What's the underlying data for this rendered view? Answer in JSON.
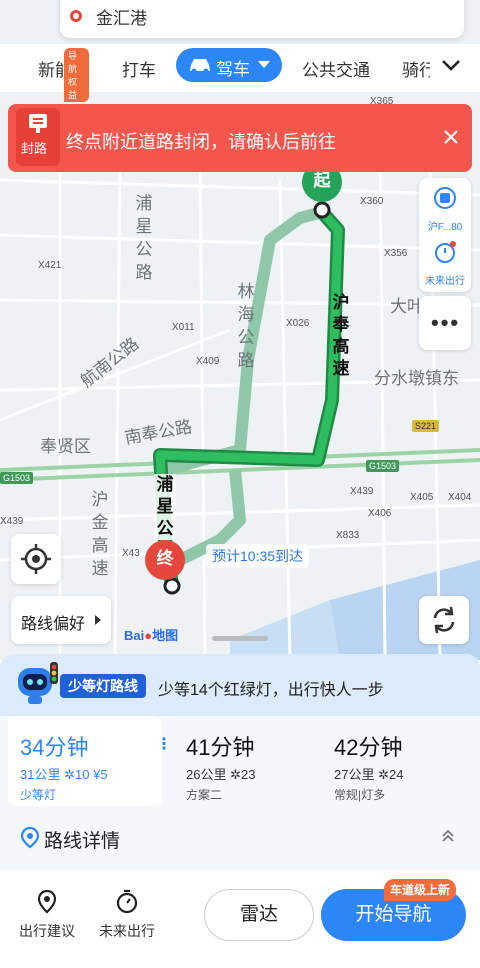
{
  "search": {
    "destination": "金汇港"
  },
  "tabs": {
    "ev": "新能源",
    "ev_badge": "导航权益",
    "taxi": "打车",
    "drive": "驾车",
    "transit": "公共交通",
    "ride": "骑行"
  },
  "alert": {
    "icon_label": "封路",
    "message": "终点附近道路封闭，请确认后前往"
  },
  "right_tools": {
    "road_label": "沪F...80",
    "weather_label": "未来出行"
  },
  "map": {
    "labels": {
      "puxing_road": "浦星公路",
      "linhai_road": "林海公路",
      "hufeng_expressway": "沪奉高速",
      "hangnan_road": "航南公路",
      "nanfeng_road": "南奉公路",
      "fengxian_district": "奉贤区",
      "fenshuidun": "分水墩镇东",
      "dake": "大叶",
      "hujin_expressway": "沪金高速",
      "route_hufeng": "沪奉高速",
      "route_puxing": "浦星公"
    },
    "road_codes": [
      "X360",
      "X365",
      "X356",
      "X421",
      "X011",
      "X026",
      "X409",
      "X439",
      "X405",
      "X404",
      "X406",
      "X833",
      "X439",
      "X43"
    ],
    "badges": {
      "g1503_a": "G1503",
      "g1503_b": "G1503",
      "s221": "S221"
    },
    "start_label": "起",
    "end_label": "终",
    "eta": "预计10:35到达",
    "route_pref": "路线偏好",
    "logo_text": "Bai",
    "logo_map": "地图"
  },
  "traffic_light": {
    "badge": "少等灯路线",
    "text": "少等14个红绿灯，出行快人一步"
  },
  "routes": [
    {
      "time": "34分钟",
      "distance": "31公里",
      "lights": "10",
      "toll": "¥5",
      "tag": "少等灯",
      "selected": true
    },
    {
      "time": "41分钟",
      "distance": "26公里",
      "lights": "23",
      "toll": "",
      "tag": "方案二",
      "selected": false
    },
    {
      "time": "42分钟",
      "distance": "27公里",
      "lights": "24",
      "toll": "",
      "tag": "常规|灯多",
      "selected": false
    }
  ],
  "detail": {
    "label": "路线详情"
  },
  "bottom": {
    "travel_advice": "出行建议",
    "future_travel": "未来出行",
    "radar": "雷达",
    "start_nav": "开始导航",
    "lane_badge": "车道级上新"
  },
  "colors": {
    "accent": "#2d86f5",
    "route_green": "#2aa257",
    "alert_red": "#f2564d"
  }
}
